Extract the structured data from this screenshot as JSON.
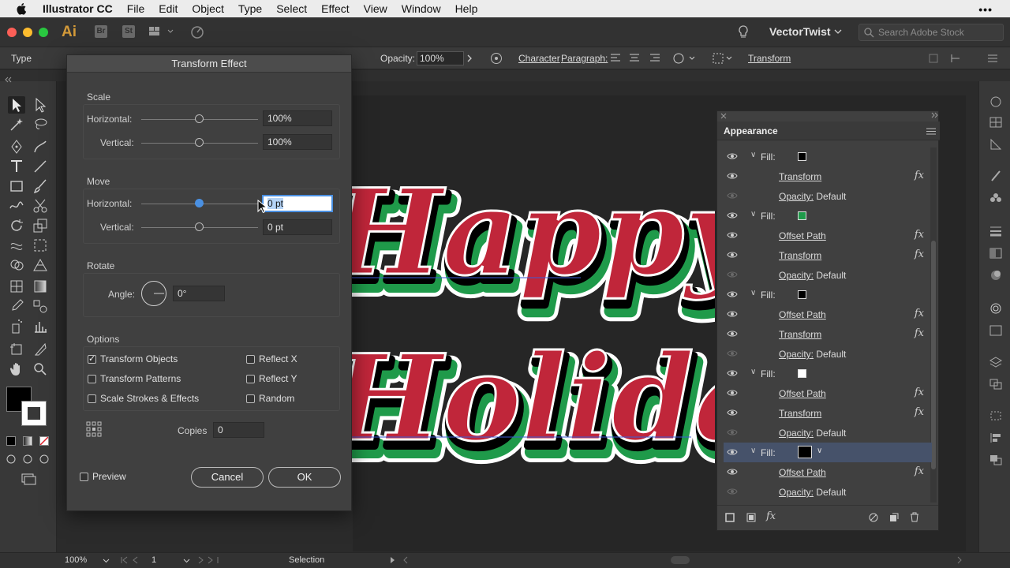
{
  "menubar": {
    "app_name": "Illustrator CC",
    "items": [
      "File",
      "Edit",
      "Object",
      "Type",
      "Select",
      "Effect",
      "View",
      "Window",
      "Help"
    ],
    "more": "•••"
  },
  "appbar": {
    "logo": "Ai",
    "br": "Br",
    "st": "St",
    "workspace": "VectorTwist",
    "search_placeholder": "Search Adobe Stock"
  },
  "controlbar": {
    "type_label": "Type",
    "opacity_label": "Opacity:",
    "opacity_value": "100%",
    "character": "Character",
    "paragraph": "Paragraph:",
    "transform": "Transform"
  },
  "dialog": {
    "title": "Transform Effect",
    "scale": {
      "label": "Scale",
      "horizontal_label": "Horizontal:",
      "horizontal_value": "100%",
      "vertical_label": "Vertical:",
      "vertical_value": "100%"
    },
    "move": {
      "label": "Move",
      "horizontal_label": "Horizontal:",
      "horizontal_value": "0 pt",
      "vertical_label": "Vertical:",
      "vertical_value": "0 pt"
    },
    "rotate": {
      "label": "Rotate",
      "angle_label": "Angle:",
      "angle_value": "0°"
    },
    "options": {
      "label": "Options",
      "transform_objects": "Transform Objects",
      "transform_objects_checked": true,
      "transform_patterns": "Transform Patterns",
      "scale_strokes": "Scale Strokes & Effects",
      "reflect_x": "Reflect X",
      "reflect_y": "Reflect Y",
      "random": "Random"
    },
    "copies_label": "Copies",
    "copies_value": "0",
    "preview_label": "Preview",
    "cancel_label": "Cancel",
    "ok_label": "OK"
  },
  "appearance": {
    "title": "Appearance",
    "rows": [
      {
        "kind": "fill",
        "label": "Fill:",
        "swatch": "#000000"
      },
      {
        "kind": "effect",
        "label": "Transform"
      },
      {
        "kind": "opacity",
        "label": "Opacity:",
        "value": "Default"
      },
      {
        "kind": "fill",
        "label": "Fill:",
        "swatch": "#1f9a4a"
      },
      {
        "kind": "effect",
        "label": "Offset Path"
      },
      {
        "kind": "effect",
        "label": "Transform"
      },
      {
        "kind": "opacity",
        "label": "Opacity:",
        "value": "Default"
      },
      {
        "kind": "fill",
        "label": "Fill:",
        "swatch": "#000000"
      },
      {
        "kind": "effect",
        "label": "Offset Path"
      },
      {
        "kind": "effect",
        "label": "Transform"
      },
      {
        "kind": "opacity",
        "label": "Opacity:",
        "value": "Default"
      },
      {
        "kind": "fill",
        "label": "Fill:",
        "swatch": "#ffffff"
      },
      {
        "kind": "effect",
        "label": "Offset Path"
      },
      {
        "kind": "effect",
        "label": "Transform"
      },
      {
        "kind": "opacity",
        "label": "Opacity:",
        "value": "Default"
      },
      {
        "kind": "fill",
        "label": "Fill:",
        "swatch": "#000000",
        "selected": true
      },
      {
        "kind": "effect",
        "label": "Offset Path"
      },
      {
        "kind": "opacity",
        "label": "Opacity:",
        "value": "Default"
      }
    ],
    "fx_glyph": "fx"
  },
  "artwork": {
    "line1": "Happy",
    "line2": "Holidays",
    "colors": {
      "fill": "#c0263a",
      "stroke1": "#ffffff",
      "stroke2": "#1f9a4a",
      "shadow": "#000000"
    }
  },
  "statusbar": {
    "zoom": "100%",
    "artboard": "1",
    "tool": "Selection"
  }
}
